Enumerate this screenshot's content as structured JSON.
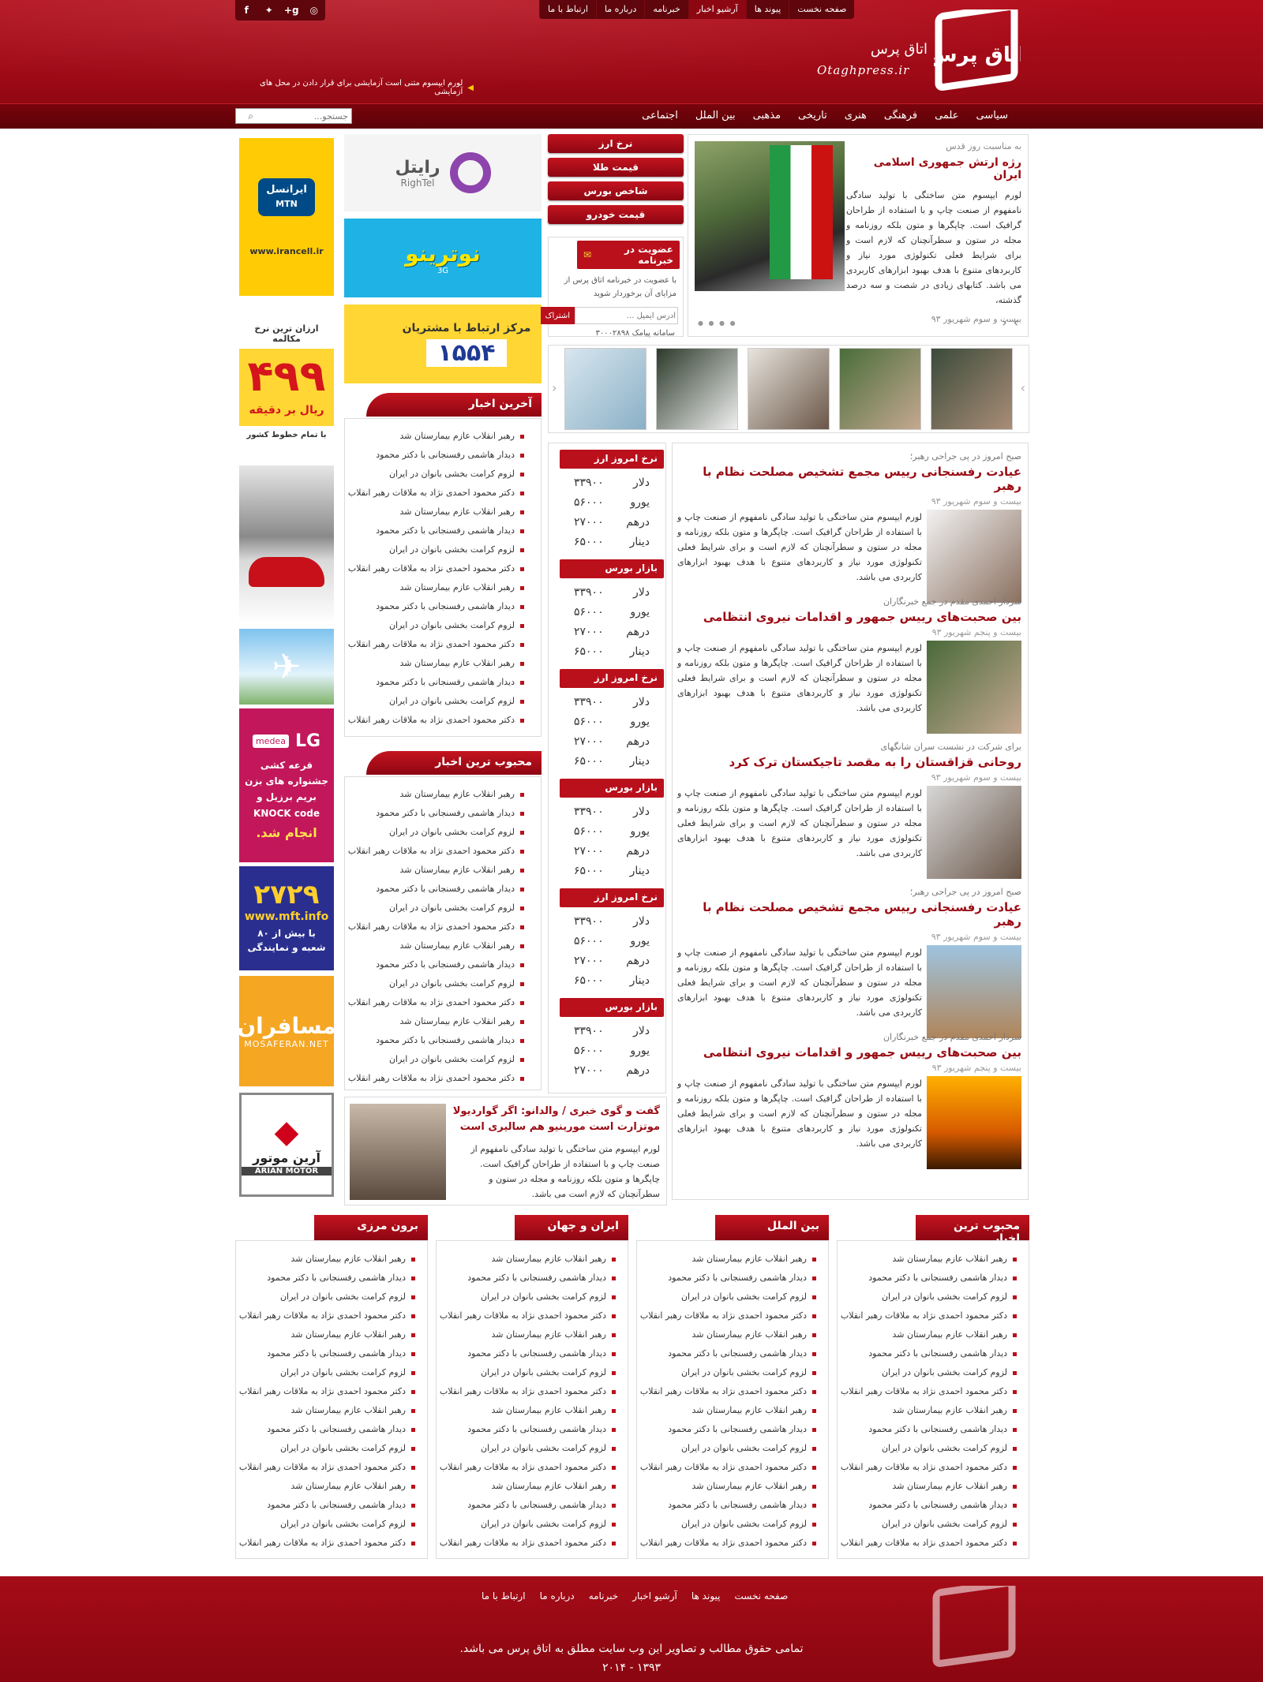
{
  "top_nav": [
    "صفحه نخست",
    "پیوند ها",
    "آرشیو اخبار",
    "خبرنامه",
    "درباره ما",
    "ارتباط با ما"
  ],
  "social": [
    "instagram-icon",
    "googleplus-icon",
    "twitter-icon",
    "facebook-icon"
  ],
  "brand": {
    "name_fa": "اتاق پرس",
    "name_en": "Otaghpress.ir",
    "logo_text": "اتاق پرس"
  },
  "ticker": "لورم ایپسوم متنی است آزمایشی برای قرار دادن در محل های آزمایشی",
  "main_nav": [
    "سیاسی",
    "علمی",
    "فرهنگی",
    "هنری",
    "تاریخی",
    "مذهبی",
    "بین الملل",
    "اجتماعی"
  ],
  "search": {
    "placeholder": "جستجو..."
  },
  "slider": {
    "kicker": "به مناسبت روز قدس",
    "title": "رژه ارتش جمهوری اسلامی ایران",
    "body": "لورم ایپسوم متن ساختگی با تولید سادگی نامفهوم از صنعت چاپ و با استفاده از طراحان گرافیک است. چاپگرها و متون بلکه روزنامه و مجله در ستون و سطرآنچنان که لازم است و برای شرایط فعلی تکنولوژی مورد نیاز و کاربردهای متنوع با هدف بهبود ابزارهای کاربردی می باشد. کتابهای زیادی در شصت و سه درصد گذشته،",
    "date": "بیست و سوم شهریور ۹۳"
  },
  "market_buttons": [
    "نرخ ارز",
    "قیمت طلا",
    "شاخص بورس",
    "قیمت خودرو"
  ],
  "newsletter": {
    "title": "عضویت در خبرنامه",
    "text": "با عضویت در خبرنامه اتاق پرس از مزایای آن برخوردار شوید",
    "placeholder": "آدرس ایمیل ...",
    "button": "اشتراک",
    "sms": "سامانه پیامک ۳۰۰۰۲۸۹۸"
  },
  "news": [
    {
      "kicker": "صبح امروز در پی جراحی رهبر؛",
      "title": "عیادت رفسنجانی رییس مجمع تشخیص مصلحت نظام با رهبر",
      "date": "بیست و سوم شهریور ۹۳",
      "body": "لورم ایپسوم متن ساختگی با تولید سادگی نامفهوم از صنعت چاپ و با استفاده از طراحان گرافیک است. چاپگرها و متون بلکه روزنامه و مجله در ستون و سطرآنچنان که لازم است و برای شرایط فعلی تکنولوژی مورد نیاز و کاربردهای متنوع با هدف بهبود ابزارهای کاربردی می باشد."
    },
    {
      "kicker": "سردار احمدی مقدم در جمع خبرنگاران",
      "title": "بین صحبت‌های رییس جمهور و اقدامات نیروی انتظامی",
      "date": "بیست و پنجم شهریور ۹۳",
      "body": "لورم ایپسوم متن ساختگی با تولید سادگی نامفهوم از صنعت چاپ و با استفاده از طراحان گرافیک است. چاپگرها و متون بلکه روزنامه و مجله در ستون و سطرآنچنان که لازم است و برای شرایط فعلی تکنولوژی مورد نیاز و کاربردهای متنوع با هدف بهبود ابزارهای کاربردی می باشد."
    },
    {
      "kicker": "برای شرکت در نشست سران شانگهای",
      "title": "روحانی قزاقستان را به مقصد تاجیکستان ترک کرد",
      "date": "بیست و سوم شهریور ۹۳",
      "body": "لورم ایپسوم متن ساختگی با تولید سادگی نامفهوم از صنعت چاپ و با استفاده از طراحان گرافیک است. چاپگرها و متون بلکه روزنامه و مجله در ستون و سطرآنچنان که لازم است و برای شرایط فعلی تکنولوژی مورد نیاز و کاربردهای متنوع با هدف بهبود ابزارهای کاربردی می باشد."
    },
    {
      "kicker": "صبح امروز در پی جراحی رهبر؛",
      "title": "عیادت رفسنجانی رییس مجمع تشخیص مصلحت نظام با رهبر",
      "date": "بیست و سوم شهریور ۹۳",
      "body": "لورم ایپسوم متن ساختگی با تولید سادگی نامفهوم از صنعت چاپ و با استفاده از طراحان گرافیک است. چاپگرها و متون بلکه روزنامه و مجله در ستون و سطرآنچنان که لازم است و برای شرایط فعلی تکنولوژی مورد نیاز و کاربردهای متنوع با هدف بهبود ابزارهای کاربردی می باشد."
    },
    {
      "kicker": "سردار احمدی مقدم در جمع خبرنگاران",
      "title": "بین صحبت‌های رییس جمهور و اقدامات نیروی انتظامی",
      "date": "بیست و پنجم شهریور ۹۳",
      "body": "لورم ایپسوم متن ساختگی با تولید سادگی نامفهوم از صنعت چاپ و با استفاده از طراحان گرافیک است. چاپگرها و متون بلکه روزنامه و مجله در ستون و سطرآنچنان که لازم است و برای شرایط فعلی تکنولوژی مورد نیاز و کاربردهای متنوع با هدف بهبود ابزارهای کاربردی می باشد."
    }
  ],
  "rate_boxes": [
    {
      "title": "نرخ امروز ارز"
    },
    {
      "title": "بازار بورس"
    },
    {
      "title": "نرخ امروز ارز"
    },
    {
      "title": "بازار بورس"
    },
    {
      "title": "نرخ امروز ارز"
    },
    {
      "title": "بازار بورس"
    }
  ],
  "rate_labels": [
    "دلار",
    "یورو",
    "درهم",
    "دینار"
  ],
  "rate_values": [
    "۳۳۹۰۰",
    "۵۶۰۰۰",
    "۲۷۰۰۰",
    "۶۵۰۰۰"
  ],
  "latest_title": "آخرین اخبار",
  "popular_title": "محبوب ترین اخبار",
  "headlines": [
    "رهبر انقلاب عازم بیمارستان شد",
    "دیدار هاشمی رفسنجانی با دکتر محمود",
    "لزوم کرامت بخشی بانوان در ایران",
    "دکتر محمود احمدی نژاد به ملاقات رهبر انقلاب"
  ],
  "interview": {
    "title": "گفت و گوی خبری / والدانو: اگر گواردیولا موتزارت است مورینیو هم سالیری است",
    "body": "لورم ایپسوم متن ساختگی با تولید سادگی نامفهوم از صنعت چاپ و با استفاده از طراحان گرافیک است. چاپگرها و متون بلکه روزنامه و مجله در ستون و سطرآنچنان که لازم است می باشد."
  },
  "bottom_sections": [
    "محبوب ترین اخبار",
    "بین الملل",
    "ایران و جهان",
    "برون مرزی"
  ],
  "ads": {
    "irancell": {
      "brand": "ایرانسل",
      "sub": "MTN",
      "url": "www.irancell.ir"
    },
    "rate_ad": {
      "line1": "ارزان ترین نرخ مکالمه",
      "price": "۴۹۹",
      "unit": "ریال بر دقیقه",
      "note": "با تمام خطوط کشور"
    },
    "lg": {
      "brand": "LG",
      "partner": "medea",
      "text": "قرعه کشی جشنواره های بزن بریم برزیل و",
      "code": "KNOCK code",
      "end": "انجام شد."
    },
    "mft": {
      "number": "۲۷۲۹",
      "url": "www.mft.info",
      "text": "با بیش از ۸۰ شعبه و نمایندگی"
    },
    "mosaferan": {
      "fa": "مسافران",
      "en": "MOSAFERAN.NET"
    },
    "mitsubishi": {
      "fa": "آرین موتور",
      "en": "ARIAN MOTOR"
    },
    "rightel": {
      "fa": "رایتل",
      "en": "RighTel"
    },
    "notrino": {
      "text": "نوترینو",
      "sub": "3G"
    },
    "support": {
      "text": "مرکز ارتباط با مشتریان",
      "number": "۱۵۵۴"
    }
  },
  "footer": {
    "links": [
      "صفحه نخست",
      "پیوند ها",
      "آرشیو اخبار",
      "خبرنامه",
      "درباره ما",
      "ارتباط با ما"
    ],
    "copyright": "تمامی حقوق مطالب و تصاویر این وب سایت مطلق به اتاق پرس می باشد.",
    "years": "۱۳۹۳ - ۲۰۱۴"
  },
  "colors": {
    "brand_red": "#b9101b",
    "dark_red": "#5f050c",
    "link_red": "#9a0c14"
  }
}
